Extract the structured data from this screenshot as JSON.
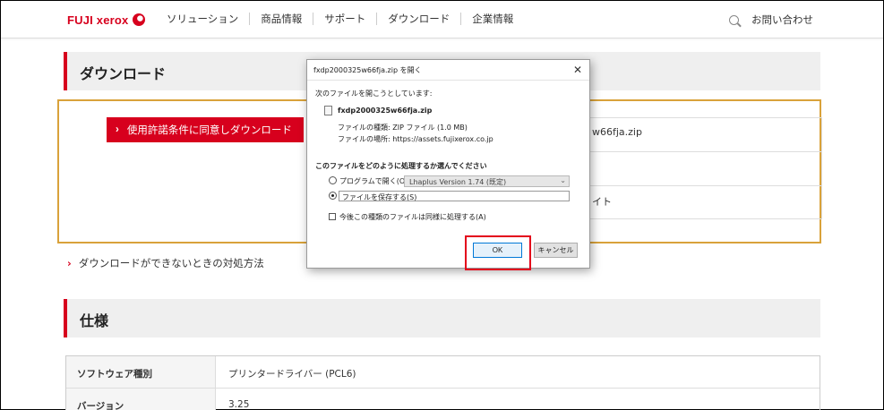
{
  "header": {
    "logo_text": "FUJI xerox",
    "nav": [
      "ソリューション",
      "商品情報",
      "サポート",
      "ダウンロード",
      "企業情報"
    ],
    "contact_label": "お問い合わせ"
  },
  "download_section": {
    "title": "ダウンロード",
    "agree_button": "使用許諾条件に同意しダウンロード",
    "file_rows": [
      "w66fja.zip",
      "",
      "イト"
    ],
    "help_link": "ダウンロードができないときの対処方法"
  },
  "spec_section": {
    "title": "仕様",
    "rows": [
      {
        "key": "ソフトウェア種別",
        "value": "プリンタードライバー (PCL6)"
      },
      {
        "key": "バージョン",
        "value": "3.25"
      }
    ]
  },
  "dialog": {
    "title": "fxdp2000325w66fja.zip を開く",
    "intro": "次のファイルを開こうとしています:",
    "filename": "fxdp2000325w66fja.zip",
    "file_type": "ファイルの種類: ZIP ファイル (1.0 MB)",
    "file_source": "ファイルの場所: https://assets.fujixerox.co.jp",
    "question": "このファイルをどのように処理するか選んでください",
    "open_with_label": "プログラムで開く(O):",
    "open_with_program": "Lhaplus Version 1.74 (既定)",
    "save_label": "ファイルを保存する(S)",
    "remember_label": "今後この種類のファイルは同様に処理する(A)",
    "ok": "OK",
    "cancel": "キャンセル",
    "selected_option": "save",
    "remember_checked": false
  },
  "colors": {
    "brand_red": "#d7001d",
    "box_border": "#d9a23a",
    "highlight": "#e3001b"
  }
}
